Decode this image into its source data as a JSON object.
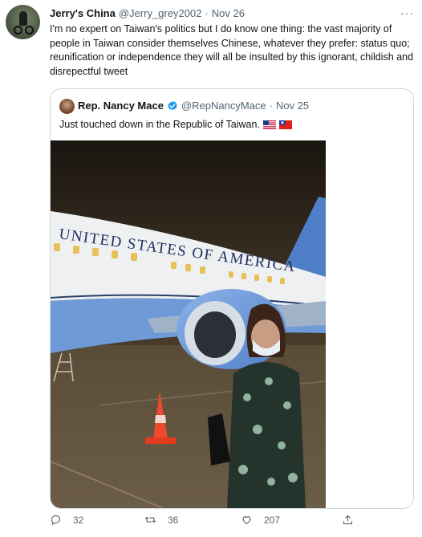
{
  "tweet": {
    "author_name": "Jerry's China",
    "author_handle": "@Jerry_grey2002",
    "separator": "·",
    "date": "Nov 26",
    "more_label": "···",
    "text": "I'm no expert on Taiwan's politics but I do know one thing: the vast majority of people in Taiwan consider themselves Chinese, whatever they prefer: status quo; reunification or independence they will all be insulted by this ignorant, childish and disrepectful tweet"
  },
  "quoted": {
    "author_name": "Rep. Nancy Mace",
    "author_handle": "@RepNancyMace",
    "separator": "·",
    "date": "Nov 25",
    "text": "Just touched down in the Republic of Taiwan.",
    "aircraft_text": "UNITED STATES OF AMERICA"
  },
  "actions": {
    "reply_count": "32",
    "retweet_count": "36",
    "like_count": "207"
  },
  "colors": {
    "text_primary": "#0f1419",
    "text_secondary": "#536471",
    "border": "#cfd9de",
    "verified_blue": "#1d9bf0"
  }
}
